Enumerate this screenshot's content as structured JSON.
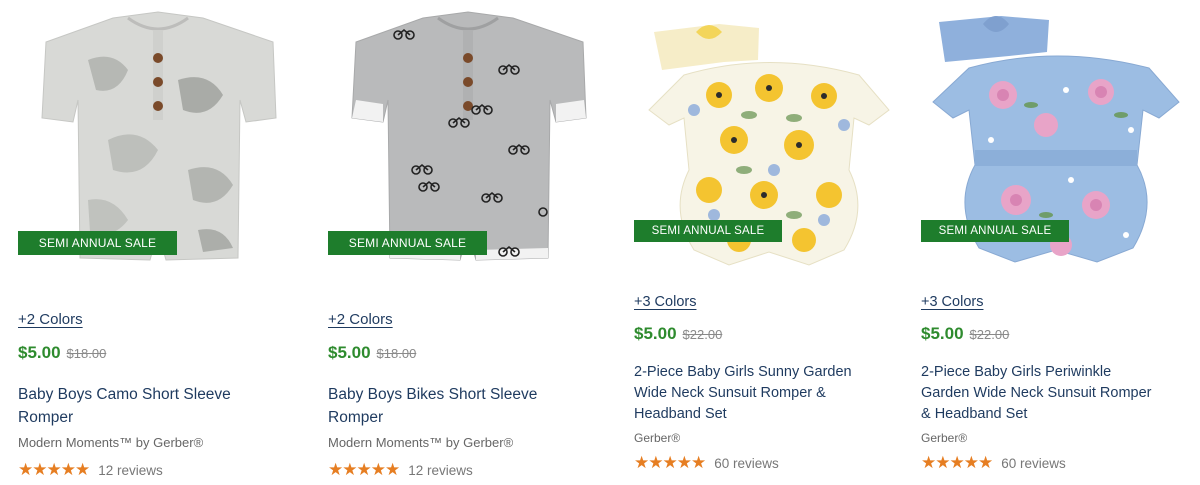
{
  "products": [
    {
      "badge": "SEMI ANNUAL SALE",
      "colors": "+2 Colors",
      "price": "$5.00",
      "original_price": "$18.00",
      "title_line1": "Baby Boys Camo Short Sleeve",
      "title_line2": "Romper",
      "title_line3": "",
      "brand": "Modern Moments™ by Gerber®",
      "rating": 5,
      "stars": "★★★★★",
      "reviews": "12 reviews"
    },
    {
      "badge": "SEMI ANNUAL SALE",
      "colors": "+2 Colors",
      "price": "$5.00",
      "original_price": "$18.00",
      "title_line1": "Baby Boys Bikes Short Sleeve",
      "title_line2": "Romper",
      "title_line3": "",
      "brand": "Modern Moments™ by Gerber®",
      "rating": 5,
      "stars": "★★★★★",
      "reviews": "12 reviews"
    },
    {
      "badge": "SEMI ANNUAL SALE",
      "colors": "+3 Colors",
      "price": "$5.00",
      "original_price": "$22.00",
      "title_line1": "2-Piece Baby Girls Sunny Garden",
      "title_line2": "Wide Neck Sunsuit Romper &",
      "title_line3": "Headband Set",
      "brand": "Gerber®",
      "rating": 5,
      "stars": "★★★★★",
      "reviews": "60 reviews"
    },
    {
      "badge": "SEMI ANNUAL SALE",
      "colors": "+3 Colors",
      "price": "$5.00",
      "original_price": "$22.00",
      "title_line1": "2-Piece Baby Girls Periwinkle",
      "title_line2": "Garden Wide Neck Sunsuit Romper",
      "title_line3": "& Headband Set",
      "brand": "Gerber®",
      "rating": 5,
      "stars": "★★★★★",
      "reviews": "60 reviews"
    }
  ],
  "colors": {
    "sale_badge": "#1e7d2c",
    "price": "#2e8b2e",
    "title": "#1e3a5f",
    "stars": "#e67e22"
  }
}
